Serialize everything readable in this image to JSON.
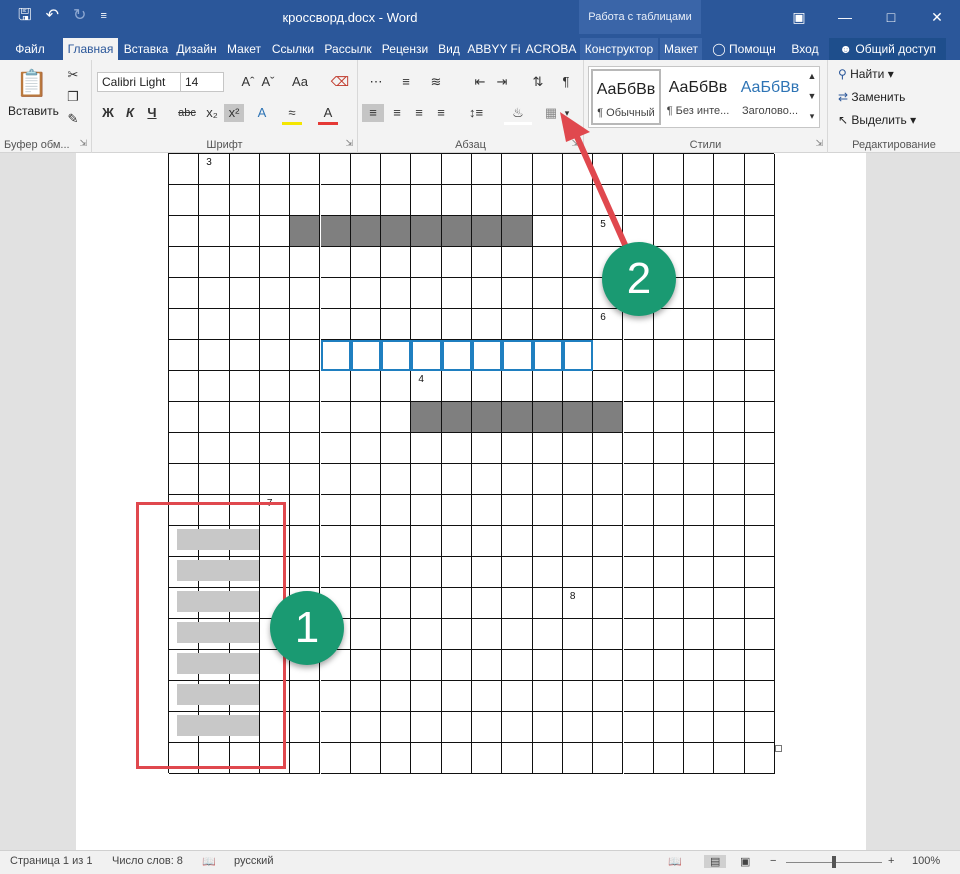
{
  "titlebar": {
    "doc_title": "кроссворд.docx - Word",
    "context_group": "Работа с таблицами",
    "qat": [
      "save-icon",
      "undo-icon",
      "redo-icon",
      "customize-icon"
    ],
    "window_buttons": [
      "ribbon-display-icon",
      "minimize-icon",
      "maximize-icon",
      "close-icon"
    ]
  },
  "tabs": {
    "items": [
      "Файл",
      "Главная",
      "Вставка",
      "Дизайн",
      "Макет",
      "Ссылки",
      "Рассылк",
      "Рецензи",
      "Вид",
      "ABBYY Fi",
      "ACROBA",
      "Конструктор",
      "Макет",
      "Помощн",
      "Вход"
    ],
    "active": "Главная",
    "share": "Общий доступ"
  },
  "ribbon": {
    "clipboard": {
      "paste": "Вставить",
      "label": "Буфер обм..."
    },
    "font": {
      "name": "Calibri Light",
      "size": "14",
      "bold": "Ж",
      "italic": "К",
      "underline": "Ч",
      "strike": "abc",
      "sub": "x₂",
      "sup": "x²",
      "label": "Шрифт"
    },
    "paragraph": {
      "label": "Абзац"
    },
    "styles": {
      "label": "Стили",
      "items": [
        {
          "preview": "АаБбВв",
          "name": "¶ Обычный"
        },
        {
          "preview": "АаБбВв",
          "name": "¶ Без инте..."
        },
        {
          "preview": "АаБбВв",
          "name": "Заголово..."
        }
      ]
    },
    "editing": {
      "find": "Найти",
      "replace": "Заменить",
      "select": "Выделить",
      "label": "Редактирование"
    }
  },
  "crossword": {
    "rows": 20,
    "cols": 20,
    "numbers": [
      {
        "row": 0,
        "col": 1,
        "n": "3"
      },
      {
        "row": 2,
        "col": 14,
        "n": "5"
      },
      {
        "row": 5,
        "col": 14,
        "n": "6"
      },
      {
        "row": 7,
        "col": 8,
        "n": "4"
      },
      {
        "row": 11,
        "col": 3,
        "n": "7"
      },
      {
        "row": 14,
        "col": 13,
        "n": "8"
      }
    ],
    "dark_runs": [
      {
        "row": 2,
        "from": 4,
        "to": 11
      },
      {
        "row": 8,
        "from": 8,
        "to": 14
      }
    ],
    "blue_run": {
      "row": 6,
      "from": 5,
      "to": 13
    },
    "gray_block": {
      "rows_from": 12,
      "rows_to": 18,
      "cols_from": 0,
      "cols_to": 2
    }
  },
  "annotations": {
    "badge1": "1",
    "badge2": "2"
  },
  "statusbar": {
    "page": "Страница 1 из 1",
    "words": "Число слов: 8",
    "language": "русский",
    "zoom": "100%"
  }
}
